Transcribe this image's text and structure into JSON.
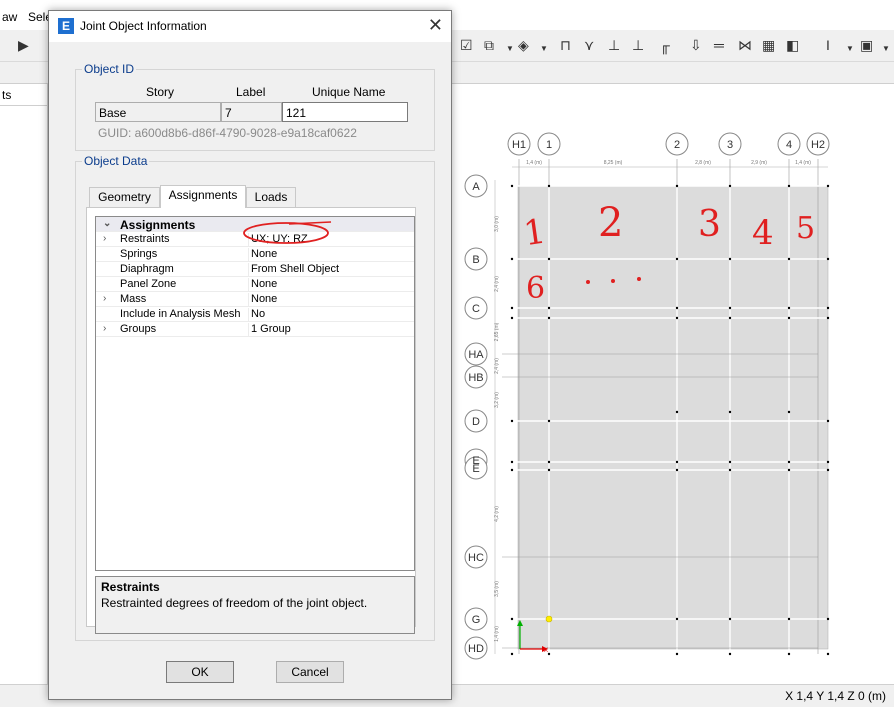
{
  "menu": {
    "item1": "aw",
    "item2": "Sele"
  },
  "left_panel": {
    "header": "ts"
  },
  "status": {
    "coords": "X 1,4  Y 1,4  Z 0 (m)"
  },
  "dialog": {
    "title": "Joint Object Information",
    "app_icon": "E",
    "close_glyph": "✕",
    "object_id": {
      "legend": "Object ID",
      "col_story": "Story",
      "col_label": "Label",
      "col_unique": "Unique Name",
      "story": "Base",
      "label": "7",
      "unique_name": "121",
      "guid": "GUID:  a600d8b6-d86f-4790-9028-e9a18caf0622"
    },
    "object_data": {
      "legend": "Object Data",
      "tabs": [
        "Geometry",
        "Assignments",
        "Loads"
      ],
      "active_tab": "Assignments",
      "section_header": "Assignments",
      "rows": [
        {
          "name": "Restraints",
          "value": "UX; UY; RZ",
          "expandable": true
        },
        {
          "name": "Springs",
          "value": "None",
          "expandable": false
        },
        {
          "name": "Diaphragm",
          "value": "From Shell Object",
          "expandable": false
        },
        {
          "name": "Panel Zone",
          "value": "None",
          "expandable": false
        },
        {
          "name": "Mass",
          "value": "None",
          "expandable": true
        },
        {
          "name": "Include in Analysis Mesh",
          "value": "No",
          "expandable": false
        },
        {
          "name": "Groups",
          "value": "1 Group",
          "expandable": true
        }
      ],
      "description_title": "Restraints",
      "description_text": "Restrainted degrees of freedom of the joint object."
    },
    "ok_label": "OK",
    "cancel_label": "Cancel"
  },
  "drawing": {
    "column_labels": [
      "H1",
      "1",
      "2",
      "3",
      "4",
      "H2"
    ],
    "row_labels": [
      "A",
      "B",
      "C",
      "HA",
      "HB",
      "D",
      "E",
      "E",
      "HC",
      "G",
      "HD"
    ],
    "top_dims": [
      "1,4 (m)",
      "8,25 (m)",
      "2,8 (m)",
      "2,9 (m)",
      "1,4 (m)"
    ],
    "side_dims": [
      "3,0 (m)",
      "2,4 (m)",
      "2,65 (m)",
      "2,4 (m)",
      "3,2 (m)",
      "4,2 (m)",
      "3,5 (m)",
      "1,4 (m)"
    ],
    "sketch_numbers": [
      "1",
      "2",
      "3",
      "4",
      "5",
      "6"
    ],
    "axis_x": "X"
  }
}
